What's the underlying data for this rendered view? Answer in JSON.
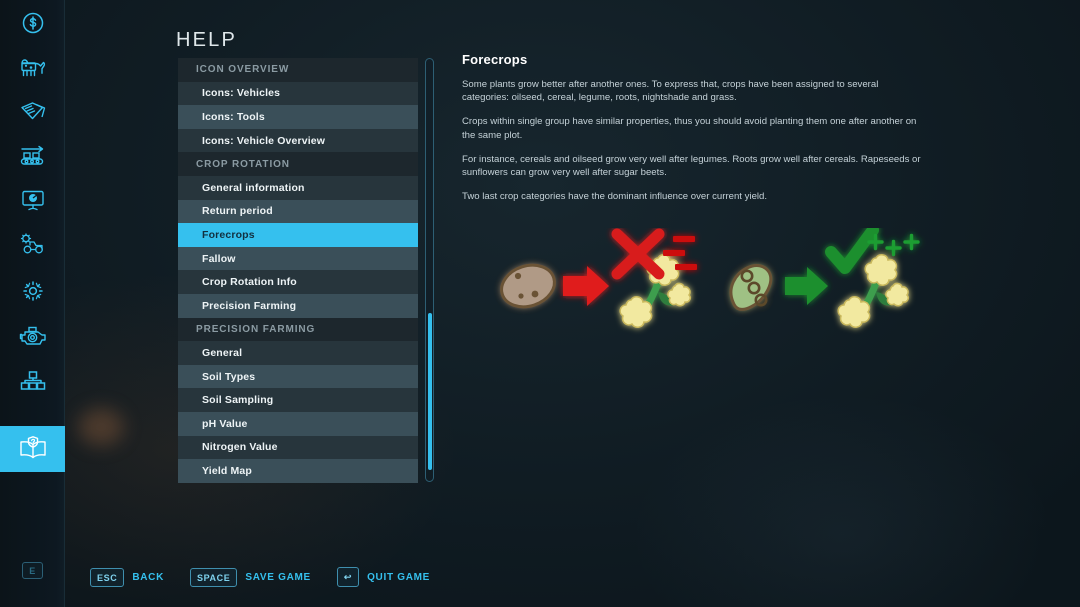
{
  "page": {
    "title": "HELP"
  },
  "colors": {
    "accent": "#35c0ee",
    "panel_dark": "#27353c",
    "panel_light": "#3a4f59",
    "header_bg": "#1d272d",
    "background": "#101c23",
    "positive": "#1f8f2e",
    "negative": "#d81f1f",
    "flower": "#f2e9a0",
    "stem": "#3e9e4e"
  },
  "sidebar": {
    "items": [
      {
        "icon": "finance-coin-icon",
        "active": false
      },
      {
        "icon": "animals-cow-icon",
        "active": false
      },
      {
        "icon": "contracts-papers-icon",
        "active": false
      },
      {
        "icon": "production-conveyor-icon",
        "active": false
      },
      {
        "icon": "statistics-board-icon",
        "active": false
      },
      {
        "icon": "vehicle-settings-icon",
        "active": false
      },
      {
        "icon": "game-settings-gear-icon",
        "active": false
      },
      {
        "icon": "engine-icon",
        "active": false
      },
      {
        "icon": "farms-hierarchy-icon",
        "active": false
      },
      {
        "icon": "help-book-icon",
        "active": true
      }
    ],
    "footer_key": "E"
  },
  "menu": {
    "items": [
      {
        "label": "ICON OVERVIEW",
        "type": "header"
      },
      {
        "label": "Icons: Vehicles",
        "type": "item"
      },
      {
        "label": "Icons: Tools",
        "type": "item"
      },
      {
        "label": "Icons: Vehicle Overview",
        "type": "item"
      },
      {
        "label": "CROP ROTATION",
        "type": "header"
      },
      {
        "label": "General information",
        "type": "item"
      },
      {
        "label": "Return period",
        "type": "item"
      },
      {
        "label": "Forecrops",
        "type": "item",
        "selected": true
      },
      {
        "label": "Fallow",
        "type": "item"
      },
      {
        "label": "Crop Rotation Info",
        "type": "item"
      },
      {
        "label": "Precision Farming",
        "type": "item"
      },
      {
        "label": "PRECISION FARMING",
        "type": "header"
      },
      {
        "label": "General",
        "type": "item"
      },
      {
        "label": "Soil Types",
        "type": "item"
      },
      {
        "label": "Soil Sampling",
        "type": "item"
      },
      {
        "label": "pH Value",
        "type": "item"
      },
      {
        "label": "Nitrogen Value",
        "type": "item"
      },
      {
        "label": "Yield Map",
        "type": "item"
      }
    ]
  },
  "content": {
    "title": "Forecrops",
    "paragraphs": [
      "Some plants grow better after another ones. To express that, crops have been assigned to several categories: oilseed, cereal, legume, roots, nightshade and grass.",
      "Crops within single group have similar properties, thus you should avoid planting them one after another on the same plot.",
      "For instance, cereals and oilseed grow very well after legumes. Roots grow well after cereals. Rapeseeds or sunflowers can grow very well after sugar beets.",
      "Two last crop categories have the dominant influence over current yield."
    ],
    "illustration": {
      "bad_example": {
        "from_crop": "potato-icon",
        "arrow": "red-arrow-right-icon",
        "to_crop": "canola-flower-icon",
        "verdict": "red-cross-icon",
        "modifier_marks": "three-red-minus-marks"
      },
      "good_example": {
        "from_crop": "soybean-pod-icon",
        "arrow": "green-arrow-right-icon",
        "to_crop": "canola-flower-icon",
        "verdict": "green-check-icon",
        "modifier_marks": "three-green-plus-marks"
      }
    }
  },
  "bottom_bar": {
    "hints": [
      {
        "key": "ESC",
        "label": "BACK"
      },
      {
        "key": "SPACE",
        "label": "SAVE GAME"
      },
      {
        "key": "↩",
        "label": "QUIT GAME"
      }
    ]
  }
}
